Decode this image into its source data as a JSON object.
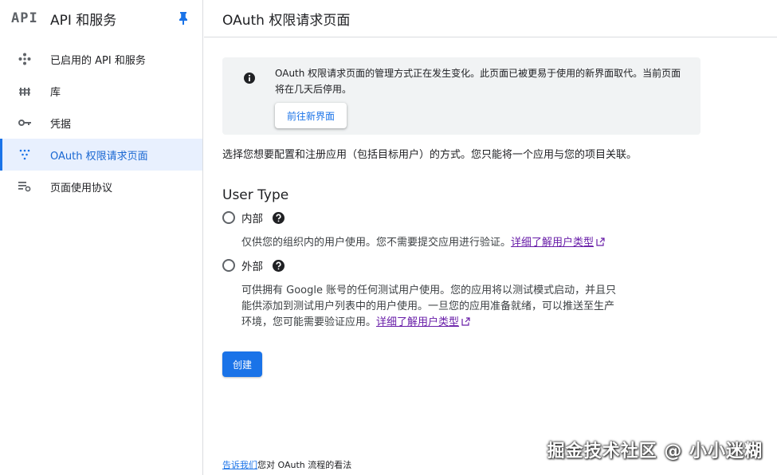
{
  "sidebar": {
    "logo": "API",
    "title": "API 和服务",
    "items": [
      {
        "label": "已启用的 API 和服务",
        "icon": "api-diamond-icon",
        "active": false
      },
      {
        "label": "库",
        "icon": "library-icon",
        "active": false
      },
      {
        "label": "凭据",
        "icon": "key-icon",
        "active": false
      },
      {
        "label": "OAuth 权限请求页面",
        "icon": "oauth-dots-icon",
        "active": true
      },
      {
        "label": "页面使用协议",
        "icon": "page-settings-icon",
        "active": false
      }
    ]
  },
  "header": {
    "title": "OAuth 权限请求页面"
  },
  "notice": {
    "text": "OAuth 权限请求页面的管理方式正在发生变化。此页面已被更易于使用的新界面取代。当前页面将在几天后停用。",
    "button_label": "前往新界面"
  },
  "main": {
    "description": "选择您想要配置和注册应用（包括目标用户）的方式。您只能将一个应用与您的项目关联。",
    "user_type_title": "User Type",
    "options": [
      {
        "label": "内部",
        "desc": "仅供您的组织内的用户使用。您不需要提交应用进行验证。",
        "link": "详细了解用户类型"
      },
      {
        "label": "外部",
        "desc": "可供拥有 Google 账号的任何测试用户使用。您的应用将以测试模式启动，并且只能供添加到测试用户列表中的用户使用。一旦您的应用准备就绪，可以推送至生产环境，您可能需要验证应用。",
        "link": "详细了解用户类型"
      }
    ],
    "create_label": "创建"
  },
  "feedback": {
    "link": "告诉我们",
    "text": "您对 OAuth 流程的看法"
  },
  "watermark": "掘金技术社区 @ 小小迷糊",
  "colors": {
    "accent": "#1a73e8",
    "link_visited": "#681da8",
    "active_bg": "#e8f0fe"
  }
}
